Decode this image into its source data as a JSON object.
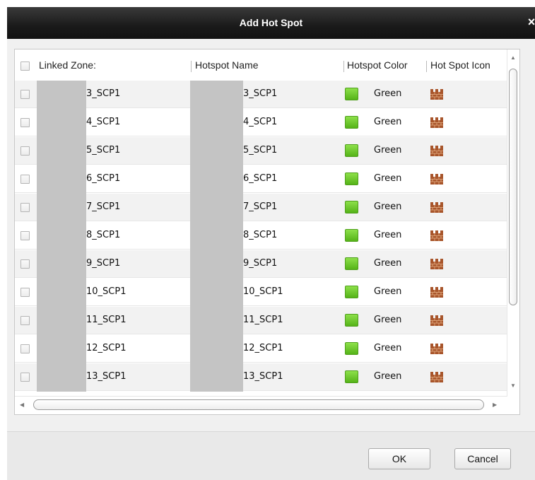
{
  "dialog": {
    "title": "Add Hot Spot",
    "close_glyph": "×"
  },
  "table": {
    "columns": {
      "linked_zone": "Linked Zone:",
      "hotspot_name": "Hotspot Name",
      "hotspot_color": "Hotspot Color",
      "hotspot_icon": "Hot Spot Icon"
    },
    "rows": [
      {
        "zone": "3_SCP1",
        "name": "3_SCP1",
        "color": "Green",
        "icon": "brick-wall-icon"
      },
      {
        "zone": "4_SCP1",
        "name": "4_SCP1",
        "color": "Green",
        "icon": "brick-wall-icon"
      },
      {
        "zone": "5_SCP1",
        "name": "5_SCP1",
        "color": "Green",
        "icon": "brick-wall-icon"
      },
      {
        "zone": "6_SCP1",
        "name": "6_SCP1",
        "color": "Green",
        "icon": "brick-wall-icon"
      },
      {
        "zone": "7_SCP1",
        "name": "7_SCP1",
        "color": "Green",
        "icon": "brick-wall-icon"
      },
      {
        "zone": "8_SCP1",
        "name": "8_SCP1",
        "color": "Green",
        "icon": "brick-wall-icon"
      },
      {
        "zone": "9_SCP1",
        "name": "9_SCP1",
        "color": "Green",
        "icon": "brick-wall-icon"
      },
      {
        "zone": "10_SCP1",
        "name": "10_SCP1",
        "color": "Green",
        "icon": "brick-wall-icon"
      },
      {
        "zone": "11_SCP1",
        "name": "11_SCP1",
        "color": "Green",
        "icon": "brick-wall-icon"
      },
      {
        "zone": "12_SCP1",
        "name": "12_SCP1",
        "color": "Green",
        "icon": "brick-wall-icon"
      },
      {
        "zone": "13_SCP1",
        "name": "13_SCP1",
        "color": "Green",
        "icon": "brick-wall-icon"
      }
    ]
  },
  "buttons": {
    "ok": "OK",
    "cancel": "Cancel"
  },
  "colors": {
    "green_swatch": "#55b318",
    "brick": "#a8552b"
  }
}
